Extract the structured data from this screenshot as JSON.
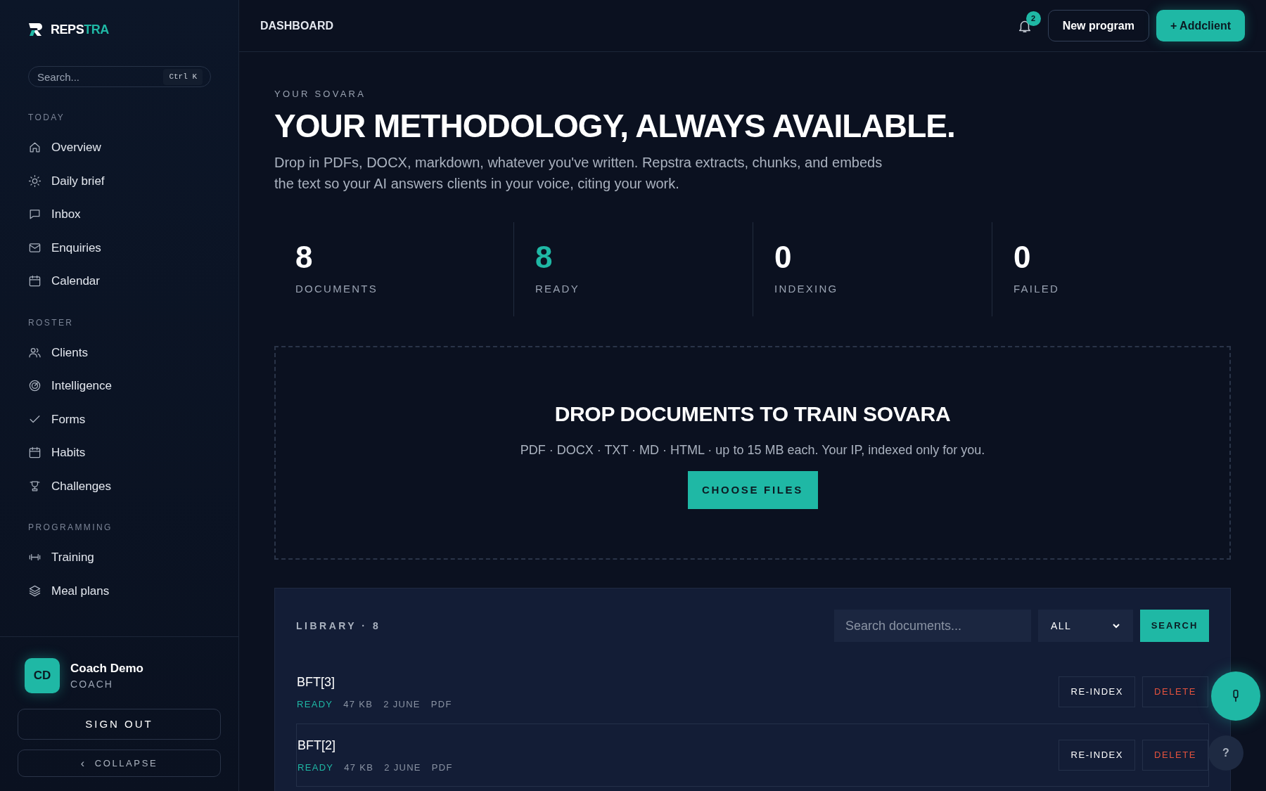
{
  "sidebar": {
    "logo": {
      "part_1": "REPS",
      "part_2": "TRA"
    },
    "search": {
      "placeholder": "Search...",
      "shortcut": "Ctrl K"
    },
    "sections": [
      {
        "title": "TODAY",
        "items": [
          {
            "label": "Overview"
          },
          {
            "label": "Daily brief"
          },
          {
            "label": "Inbox"
          },
          {
            "label": "Enquiries"
          },
          {
            "label": "Calendar"
          }
        ]
      },
      {
        "title": "ROSTER",
        "items": [
          {
            "label": "Clients"
          },
          {
            "label": "Intelligence"
          },
          {
            "label": "Forms"
          },
          {
            "label": "Habits"
          },
          {
            "label": "Challenges"
          }
        ]
      },
      {
        "title": "PROGRAMMING",
        "items": [
          {
            "label": "Training"
          },
          {
            "label": "Meal plans"
          }
        ]
      }
    ],
    "user": {
      "initials": "CD",
      "name": "Coach Demo",
      "role": "COACH"
    },
    "sign_out": "SIGN OUT",
    "collapse": {
      "icon": "‹",
      "label": "COLLAPSE"
    }
  },
  "header": {
    "title": "DASHBOARD",
    "notification_count": "2",
    "buttons": [
      {
        "label": "New program",
        "kind": "outline"
      },
      {
        "label": "+ Addclient",
        "kind": "primary"
      }
    ]
  },
  "hero": {
    "eyebrow": "YOUR SOVARA",
    "title": "YOUR METHODOLOGY, ALWAYS AVAILABLE.",
    "description": "Drop in PDFs, DOCX, markdown, whatever you've written. Repstra extracts, chunks, and embeds the text so your AI answers clients in your voice, citing your work."
  },
  "stats": [
    {
      "value": "8",
      "label": "DOCUMENTS",
      "color": "#ffffff"
    },
    {
      "value": "8",
      "label": "READY",
      "color": "#1fb8a5"
    },
    {
      "value": "0",
      "label": "INDEXING",
      "color": "#ffffff"
    },
    {
      "value": "0",
      "label": "FAILED",
      "color": "#ffffff"
    }
  ],
  "dropzone": {
    "title": "DROP DOCUMENTS TO TRAIN SOVARA",
    "subtitle": "PDF · DOCX · TXT · MD · HTML · up to 15 MB each. Your IP, indexed only for you.",
    "button": "CHOOSE FILES"
  },
  "library": {
    "title": "LIBRARY · 8",
    "search": {
      "placeholder": "Search documents..."
    },
    "filter": "ALL",
    "search_button": "SEARCH",
    "rows": [
      {
        "name": "BFT[3]",
        "status": "READY",
        "size": "47 KB",
        "date": "2 JUNE",
        "type": "PDF",
        "highlighted": false,
        "actions": [
          "RE-INDEX",
          "DELETE"
        ]
      },
      {
        "name": "BFT[2]",
        "status": "READY",
        "size": "47 KB",
        "date": "2 JUNE",
        "type": "PDF",
        "highlighted": true,
        "actions": [
          "RE-INDEX",
          "DELETE"
        ]
      }
    ]
  },
  "help_button": "?"
}
